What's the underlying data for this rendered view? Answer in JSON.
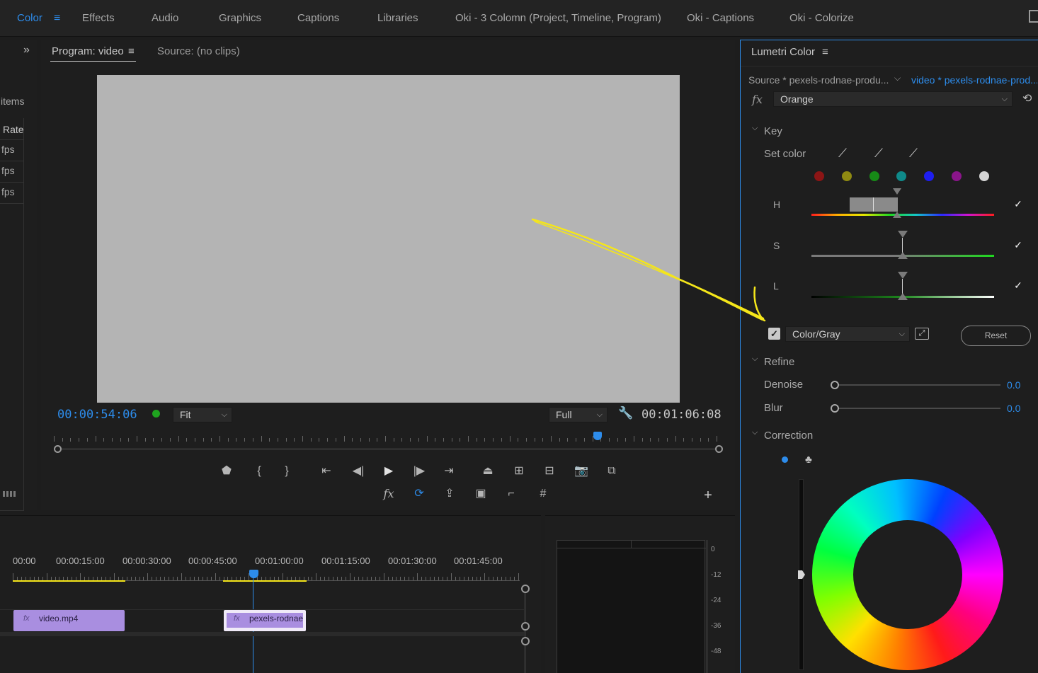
{
  "workspace_tabs": [
    {
      "label": "Color",
      "active": true
    },
    {
      "label": "Effects"
    },
    {
      "label": "Audio"
    },
    {
      "label": "Graphics"
    },
    {
      "label": "Captions"
    },
    {
      "label": "Libraries"
    },
    {
      "label": "Oki - 3 Colomn (Project, Timeline, Program)"
    },
    {
      "label": "Oki - Captions"
    },
    {
      "label": "Oki - Colorize"
    }
  ],
  "project": {
    "items_label": "items",
    "rate_header": "Rate",
    "rates": [
      "fps",
      "fps",
      "fps"
    ]
  },
  "monitor": {
    "program_tab": "Program: video",
    "source_tab": "Source: (no clips)",
    "current_time": "00:00:54:06",
    "zoom": "Fit",
    "resolution": "Full",
    "duration": "00:01:06:08",
    "frame_color": "#b4b4b4"
  },
  "timeline": {
    "ruler_labels": [
      "00:00",
      "00:00:15:00",
      "00:00:30:00",
      "00:00:45:00",
      "00:01:00:00",
      "00:01:15:00",
      "00:01:30:00",
      "00:01:45:00"
    ],
    "clips": [
      {
        "name": "video.mp4",
        "fx": "fx"
      },
      {
        "name": "pexels-rodnae",
        "fx": "fx"
      }
    ]
  },
  "meter": {
    "scale": [
      "0",
      "-12",
      "-24",
      "-36",
      "-48"
    ]
  },
  "lumetri": {
    "title": "Lumetri Color",
    "source_clip": "Source * pexels-rodnae-produ...",
    "sequence_clip": "video * pexels-rodnae-prod...",
    "fx_label": "fx",
    "effect_preset": "Orange",
    "key_section": "Key",
    "set_color_label": "Set color",
    "swatch_colors": [
      "#8c1515",
      "#8f8a12",
      "#178a17",
      "#0f8a8a",
      "#1e1ef0",
      "#8a158a",
      "#d4d4d4"
    ],
    "h_label": "H",
    "s_label": "S",
    "l_label": "L",
    "mask_mode": "Color/Gray",
    "reset_label": "Reset",
    "refine_section": "Refine",
    "denoise_label": "Denoise",
    "denoise_value": "0.0",
    "blur_label": "Blur",
    "blur_value": "0.0",
    "correction_section": "Correction"
  },
  "colors": {
    "accent": "#2d8ceb",
    "annotation": "#f5e61a",
    "clip_fill": "#a98ee0"
  }
}
